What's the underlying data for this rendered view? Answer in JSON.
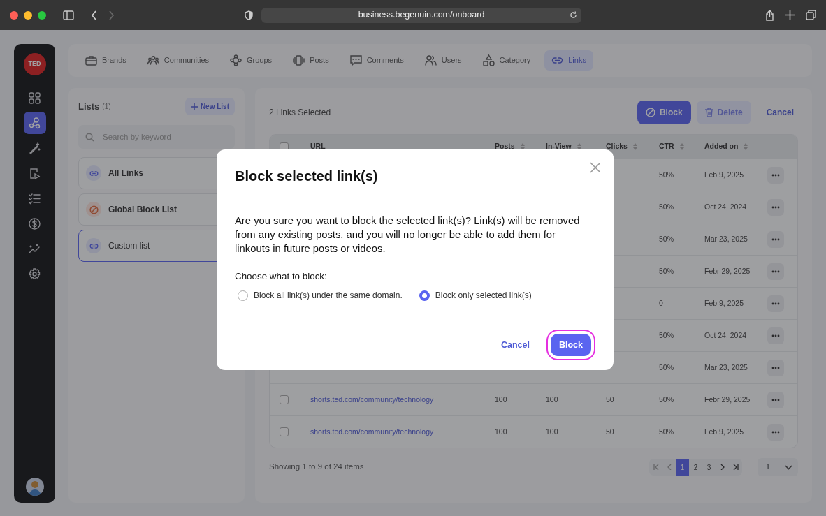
{
  "browser": {
    "url": "business.begenuin.com/onboard"
  },
  "rail": {
    "logo": "TED",
    "items": [
      {
        "selected": false
      },
      {
        "selected": true
      },
      {
        "selected": false
      },
      {
        "selected": false
      },
      {
        "selected": false
      },
      {
        "selected": false
      },
      {
        "selected": false
      },
      {
        "selected": false
      }
    ]
  },
  "tabs": [
    {
      "label": "Brands",
      "selected": false
    },
    {
      "label": "Communities",
      "selected": false
    },
    {
      "label": "Groups",
      "selected": false
    },
    {
      "label": "Posts",
      "selected": false
    },
    {
      "label": "Comments",
      "selected": false
    },
    {
      "label": "Users",
      "selected": false
    },
    {
      "label": "Category",
      "selected": false
    },
    {
      "label": "Links",
      "selected": true
    }
  ],
  "lists": {
    "title": "Lists",
    "count": "(1)",
    "new_button": "New List",
    "search": {
      "placeholder": "Search by keyword"
    },
    "items": [
      {
        "label": "All Links",
        "kind": "link",
        "selected": false
      },
      {
        "label": "Global Block List",
        "kind": "block",
        "selected": false
      },
      {
        "label": "Custom list",
        "kind": "link",
        "selected": true
      }
    ]
  },
  "toolbar": {
    "selection": "2 Links Selected",
    "block": "Block",
    "delete": "Delete",
    "cancel": "Cancel"
  },
  "table": {
    "select_all_checked": false,
    "columns": [
      {
        "label": "URL",
        "sortable": false
      },
      {
        "label": "Posts",
        "sortable": true
      },
      {
        "label": "In-View",
        "sortable": true
      },
      {
        "label": "Clicks",
        "sortable": true
      },
      {
        "label": "CTR",
        "sortable": true
      },
      {
        "label": "Added on",
        "sortable": true
      }
    ],
    "rows": [
      {
        "ctr": "50%",
        "added": "Feb 9, 2025"
      },
      {
        "ctr": "50%",
        "added": "Oct 24, 2024"
      },
      {
        "ctr": "50%",
        "added": "Mar 23, 2025"
      },
      {
        "ctr": "50%",
        "added": "Febr 29, 2025"
      },
      {
        "ctr": "0",
        "added": "Feb 9, 2025"
      },
      {
        "ctr": "50%",
        "added": "Oct 24, 2024"
      },
      {
        "ctr": "50%",
        "added": "Mar 23, 2025"
      },
      {
        "checked": false,
        "url": "shorts.ted.com/community/technology",
        "posts": "100",
        "inview": "100",
        "clicks": "50",
        "ctr": "50%",
        "added": "Febr 29, 2025"
      },
      {
        "checked": false,
        "url": "shorts.ted.com/community/technology",
        "posts": "100",
        "inview": "100",
        "clicks": "50",
        "ctr": "50%",
        "added": "Feb 9, 2025"
      }
    ]
  },
  "footer": {
    "showing": "Showing 1 to 9 of 24 items",
    "pages": [
      {
        "label": "1",
        "selected": true
      },
      {
        "label": "2",
        "selected": false
      },
      {
        "label": "3",
        "selected": false
      }
    ],
    "page_select": "1"
  },
  "modal": {
    "title": "Block selected link(s)",
    "message": "Are you sure you want to block the selected link(s)? Link(s) will be removed from any existing posts, and you will no longer be able to add them for linkouts in future posts or videos.",
    "prompt": "Choose what to block:",
    "options": [
      {
        "label": "Block all link(s) under the same domain.",
        "selected": false
      },
      {
        "label": "Block only selected link(s)",
        "selected": true
      }
    ],
    "cancel": "Cancel",
    "confirm": "Block",
    "confirm_highlighted": true
  }
}
